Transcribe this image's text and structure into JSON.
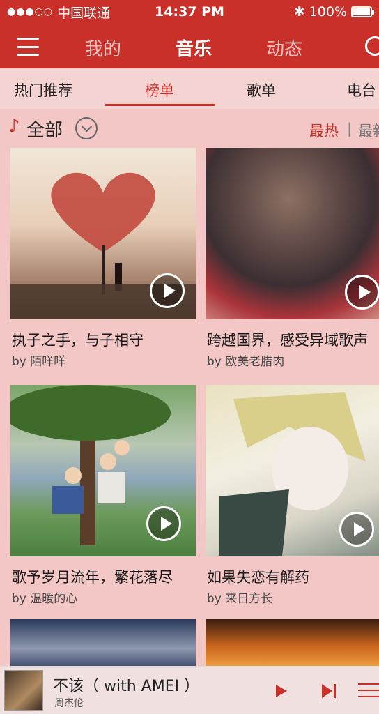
{
  "status": {
    "carrier": "中国联通",
    "time": "14:37 PM",
    "battery": "100%",
    "battery_level": 1.0
  },
  "nav": {
    "tabs": [
      "我的",
      "音乐",
      "动态"
    ],
    "active_tab": "音乐"
  },
  "subtabs": [
    "热门推荐",
    "榜单",
    "歌单",
    "电台"
  ],
  "filter": {
    "label": "全部",
    "sort_hot": "最热",
    "sort_new": "最新"
  },
  "cards": [
    {
      "title": "执子之手，与子相守",
      "by": "by 陌咩咩"
    },
    {
      "title": "跨越国界，感受异域歌声",
      "by": "by 欧美老腊肉"
    },
    {
      "title": "歌予岁月流年，繁花落尽",
      "by": "by 温暖的心"
    },
    {
      "title": "如果失恋有解药",
      "by": "by 来日方长"
    },
    {
      "title": "",
      "by": ""
    },
    {
      "title": "",
      "by": ""
    }
  ],
  "player": {
    "song": "不该（ with AMEI ）",
    "artist": "周杰伦"
  },
  "colors": {
    "accent": "#c9302a",
    "background": "#f2c7c5"
  }
}
